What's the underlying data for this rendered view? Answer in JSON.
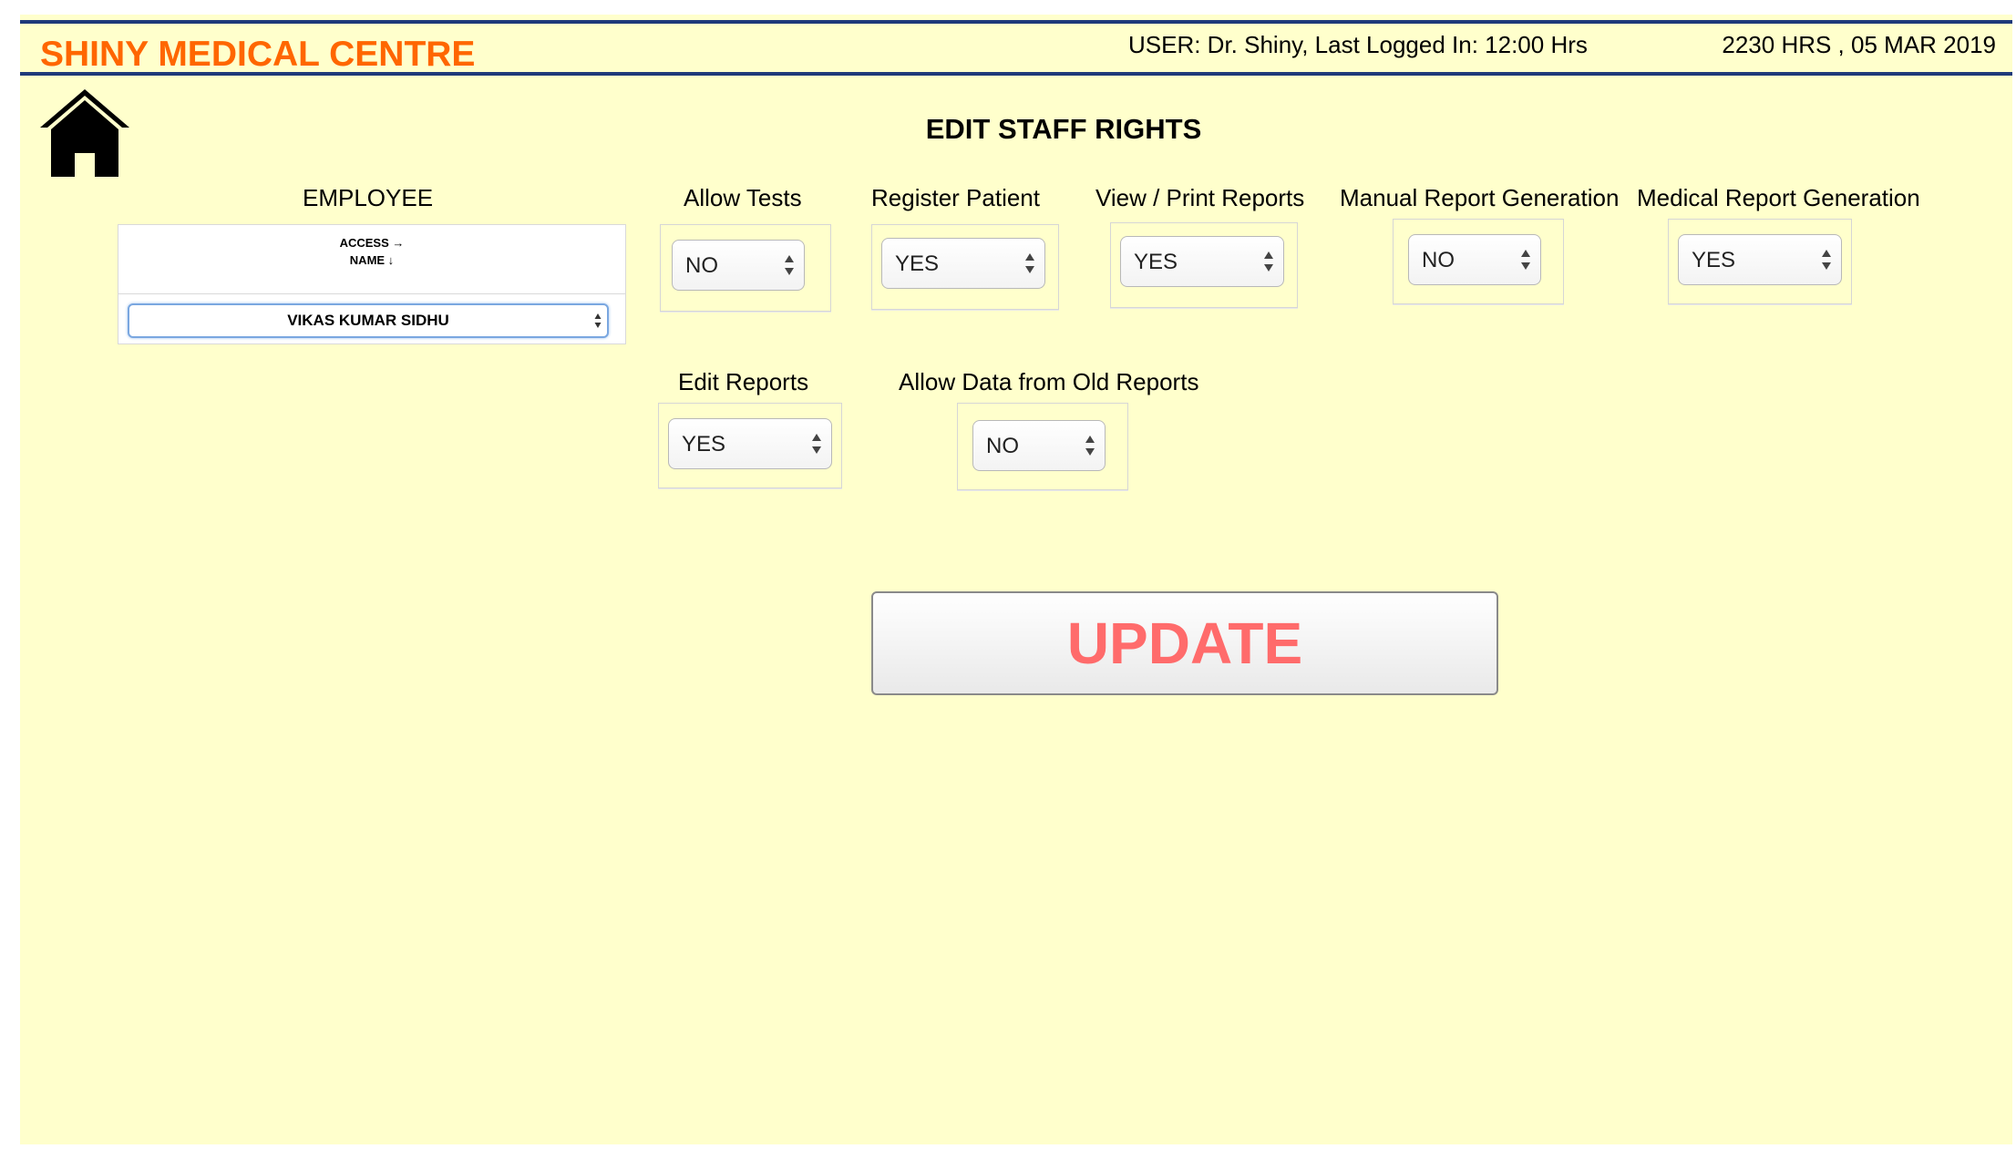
{
  "header": {
    "brand": "SHINY MEDICAL CENTRE",
    "user_info": "USER: Dr. Shiny, Last Logged In: 12:00 Hrs",
    "datetime": "2230 HRS , 05 MAR 2019"
  },
  "page": {
    "title": "EDIT STAFF RIGHTS"
  },
  "employee": {
    "label": "EMPLOYEE",
    "head_line1": "ACCESS →",
    "head_line2": "NAME ↓",
    "selected": "VIKAS KUMAR SIDHU"
  },
  "rights": {
    "allow_tests": {
      "label": "Allow Tests",
      "value": "NO"
    },
    "register_patient": {
      "label": "Register Patient",
      "value": "YES"
    },
    "view_print_reports": {
      "label": "View / Print Reports",
      "value": "YES"
    },
    "manual_report_generation": {
      "label": "Manual Report Generation",
      "value": "NO"
    },
    "medical_report_generation": {
      "label": "Medical Report Generation",
      "value": "YES"
    },
    "edit_reports": {
      "label": "Edit Reports",
      "value": "YES"
    },
    "allow_data_old_reports": {
      "label": "Allow Data from Old Reports",
      "value": "NO"
    }
  },
  "actions": {
    "update_label": "UPDATE"
  },
  "colors": {
    "brand": "#ff6600",
    "background": "#ffffcc",
    "header_rule": "#1f3a7a",
    "update_text": "#ff6b6b"
  },
  "icons": {
    "home": "home-icon",
    "select_arrows": "updown-arrows-icon"
  }
}
